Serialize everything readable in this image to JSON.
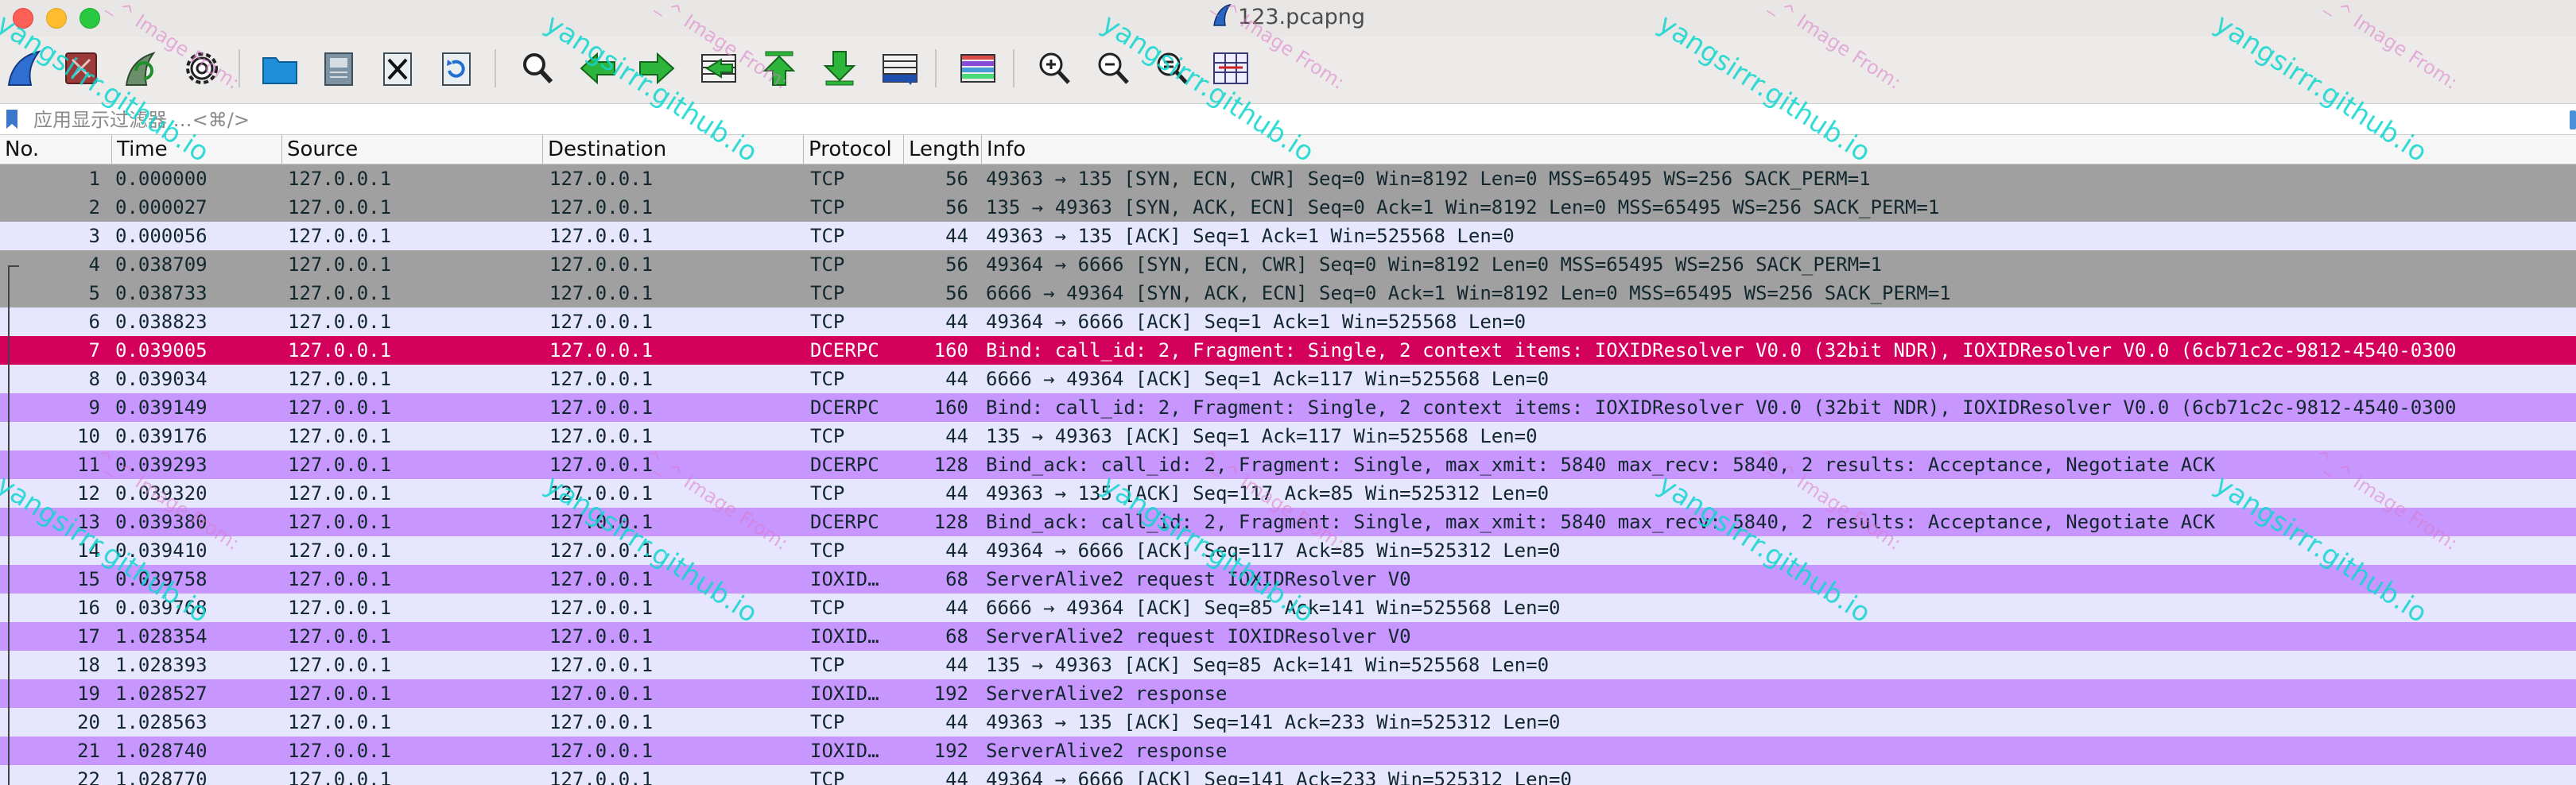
{
  "window": {
    "title": "123.pcapng"
  },
  "toolbar": {
    "buttons": [
      {
        "icon": "shark-fin-start-icon",
        "label": "Start capturing packets"
      },
      {
        "icon": "stop-capture-icon",
        "label": "Stop capturing packets"
      },
      {
        "icon": "restart-capture-icon",
        "label": "Restart current capture"
      },
      {
        "icon": "capture-options-gear-icon",
        "label": "Capture options"
      },
      {
        "icon": "open-folder-icon",
        "label": "Open a capture file"
      },
      {
        "icon": "save-file-icon",
        "label": "Save this capture file"
      },
      {
        "icon": "close-file-icon",
        "label": "Close this capture file"
      },
      {
        "icon": "reload-file-icon",
        "label": "Reload this file"
      },
      {
        "icon": "find-packet-icon",
        "label": "Find a packet"
      },
      {
        "icon": "go-back-icon",
        "label": "Go back in packet history"
      },
      {
        "icon": "go-forward-icon",
        "label": "Go forward in packet history"
      },
      {
        "icon": "go-to-packet-icon",
        "label": "Go to specified packet"
      },
      {
        "icon": "first-packet-icon",
        "label": "Go to first packet"
      },
      {
        "icon": "last-packet-icon",
        "label": "Go to last packet"
      },
      {
        "icon": "autoscroll-icon",
        "label": "Auto scroll in live capture"
      },
      {
        "icon": "colorize-icon",
        "label": "Colorize packet list"
      },
      {
        "icon": "zoom-in-icon",
        "label": "Zoom in"
      },
      {
        "icon": "zoom-out-icon",
        "label": "Zoom out"
      },
      {
        "icon": "normal-size-icon",
        "label": "Normal size"
      },
      {
        "icon": "resize-columns-icon",
        "label": "Resize columns"
      }
    ]
  },
  "filter": {
    "placeholder": "应用显示过滤器 …<⌘/>"
  },
  "columns": {
    "no": "No.",
    "time": "Time",
    "source": "Source",
    "destination": "Destination",
    "protocol": "Protocol",
    "length": "Length",
    "info": "Info"
  },
  "colors": {
    "tcp_syn_bg": "#a0a0a0",
    "tcp_bg": "#e7e6ff",
    "dcerpc_bg": "#c797ff",
    "selected_bg": "#d3005c",
    "text_dark": "#12272e",
    "text_selected": "#ffffff"
  },
  "packets": [
    {
      "no": "1",
      "time": "0.000000",
      "src": "127.0.0.1",
      "dst": "127.0.0.1",
      "proto": "TCP",
      "len": "56",
      "info": "49363 → 135 [SYN, ECN, CWR] Seq=0 Win=8192 Len=0 MSS=65495 WS=256 SACK_PERM=1",
      "style": "syn"
    },
    {
      "no": "2",
      "time": "0.000027",
      "src": "127.0.0.1",
      "dst": "127.0.0.1",
      "proto": "TCP",
      "len": "56",
      "info": "135 → 49363 [SYN, ACK, ECN] Seq=0 Ack=1 Win=8192 Len=0 MSS=65495 WS=256 SACK_PERM=1",
      "style": "syn"
    },
    {
      "no": "3",
      "time": "0.000056",
      "src": "127.0.0.1",
      "dst": "127.0.0.1",
      "proto": "TCP",
      "len": "44",
      "info": "49363 → 135 [ACK] Seq=1 Ack=1 Win=525568 Len=0",
      "style": "tcp"
    },
    {
      "no": "4",
      "time": "0.038709",
      "src": "127.0.0.1",
      "dst": "127.0.0.1",
      "proto": "TCP",
      "len": "56",
      "info": "49364 → 6666 [SYN, ECN, CWR] Seq=0 Win=8192 Len=0 MSS=65495 WS=256 SACK_PERM=1",
      "style": "syn"
    },
    {
      "no": "5",
      "time": "0.038733",
      "src": "127.0.0.1",
      "dst": "127.0.0.1",
      "proto": "TCP",
      "len": "56",
      "info": "6666 → 49364 [SYN, ACK, ECN] Seq=0 Ack=1 Win=8192 Len=0 MSS=65495 WS=256 SACK_PERM=1",
      "style": "syn"
    },
    {
      "no": "6",
      "time": "0.038823",
      "src": "127.0.0.1",
      "dst": "127.0.0.1",
      "proto": "TCP",
      "len": "44",
      "info": "49364 → 6666 [ACK] Seq=1 Ack=1 Win=525568 Len=0",
      "style": "tcp"
    },
    {
      "no": "7",
      "time": "0.039005",
      "src": "127.0.0.1",
      "dst": "127.0.0.1",
      "proto": "DCERPC",
      "len": "160",
      "info": "Bind: call_id: 2, Fragment: Single, 2 context items: IOXIDResolver V0.0 (32bit NDR), IOXIDResolver V0.0 (6cb71c2c-9812-4540-0300",
      "style": "selected"
    },
    {
      "no": "8",
      "time": "0.039034",
      "src": "127.0.0.1",
      "dst": "127.0.0.1",
      "proto": "TCP",
      "len": "44",
      "info": "6666 → 49364 [ACK] Seq=1 Ack=117 Win=525568 Len=0",
      "style": "tcp"
    },
    {
      "no": "9",
      "time": "0.039149",
      "src": "127.0.0.1",
      "dst": "127.0.0.1",
      "proto": "DCERPC",
      "len": "160",
      "info": "Bind: call_id: 2, Fragment: Single, 2 context items: IOXIDResolver V0.0 (32bit NDR), IOXIDResolver V0.0 (6cb71c2c-9812-4540-0300",
      "style": "dcerpc"
    },
    {
      "no": "10",
      "time": "0.039176",
      "src": "127.0.0.1",
      "dst": "127.0.0.1",
      "proto": "TCP",
      "len": "44",
      "info": "135 → 49363 [ACK] Seq=1 Ack=117 Win=525568 Len=0",
      "style": "tcp"
    },
    {
      "no": "11",
      "time": "0.039293",
      "src": "127.0.0.1",
      "dst": "127.0.0.1",
      "proto": "DCERPC",
      "len": "128",
      "info": "Bind_ack: call_id: 2, Fragment: Single, max_xmit: 5840 max_recv: 5840, 2 results: Acceptance, Negotiate ACK",
      "style": "dcerpc"
    },
    {
      "no": "12",
      "time": "0.039320",
      "src": "127.0.0.1",
      "dst": "127.0.0.1",
      "proto": "TCP",
      "len": "44",
      "info": "49363 → 135 [ACK] Seq=117 Ack=85 Win=525312 Len=0",
      "style": "tcp"
    },
    {
      "no": "13",
      "time": "0.039380",
      "src": "127.0.0.1",
      "dst": "127.0.0.1",
      "proto": "DCERPC",
      "len": "128",
      "info": "Bind_ack: call_id: 2, Fragment: Single, max_xmit: 5840 max_recv: 5840, 2 results: Acceptance, Negotiate ACK",
      "style": "dcerpc"
    },
    {
      "no": "14",
      "time": "0.039410",
      "src": "127.0.0.1",
      "dst": "127.0.0.1",
      "proto": "TCP",
      "len": "44",
      "info": "49364 → 6666 [ACK] Seq=117 Ack=85 Win=525312 Len=0",
      "style": "tcp"
    },
    {
      "no": "15",
      "time": "0.039758",
      "src": "127.0.0.1",
      "dst": "127.0.0.1",
      "proto": "IOXID…",
      "len": "68",
      "info": "ServerAlive2 request IOXIDResolver V0",
      "style": "dcerpc"
    },
    {
      "no": "16",
      "time": "0.039768",
      "src": "127.0.0.1",
      "dst": "127.0.0.1",
      "proto": "TCP",
      "len": "44",
      "info": "6666 → 49364 [ACK] Seq=85 Ack=141 Win=525568 Len=0",
      "style": "tcp"
    },
    {
      "no": "17",
      "time": "1.028354",
      "src": "127.0.0.1",
      "dst": "127.0.0.1",
      "proto": "IOXID…",
      "len": "68",
      "info": "ServerAlive2 request IOXIDResolver V0",
      "style": "dcerpc"
    },
    {
      "no": "18",
      "time": "1.028393",
      "src": "127.0.0.1",
      "dst": "127.0.0.1",
      "proto": "TCP",
      "len": "44",
      "info": "135 → 49363 [ACK] Seq=85 Ack=141 Win=525568 Len=0",
      "style": "tcp"
    },
    {
      "no": "19",
      "time": "1.028527",
      "src": "127.0.0.1",
      "dst": "127.0.0.1",
      "proto": "IOXID…",
      "len": "192",
      "info": "ServerAlive2 response",
      "style": "dcerpc"
    },
    {
      "no": "20",
      "time": "1.028563",
      "src": "127.0.0.1",
      "dst": "127.0.0.1",
      "proto": "TCP",
      "len": "44",
      "info": "49363 → 135 [ACK] Seq=141 Ack=233 Win=525312 Len=0",
      "style": "tcp"
    },
    {
      "no": "21",
      "time": "1.028740",
      "src": "127.0.0.1",
      "dst": "127.0.0.1",
      "proto": "IOXID…",
      "len": "192",
      "info": "ServerAlive2 response",
      "style": "dcerpc"
    },
    {
      "no": "22",
      "time": "1.028770",
      "src": "127.0.0.1",
      "dst": "127.0.0.1",
      "proto": "TCP",
      "len": "44",
      "info": "49364 → 6666 [ACK] Seq=141 Ack=233 Win=525312 Len=0",
      "style": "tcp"
    }
  ],
  "watermarks": {
    "main": "yangsirrr.github.io",
    "secondary": "^_^ Image From:"
  }
}
